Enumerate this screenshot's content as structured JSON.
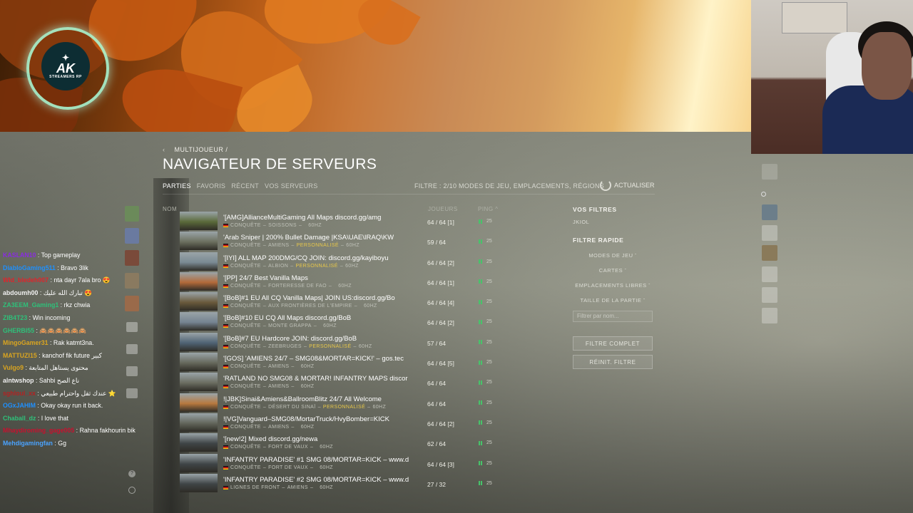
{
  "breadcrumb": {
    "back_icon": "chevron-left-icon",
    "text": "MULTIJOUEUR  /"
  },
  "page_title": "NAVIGATEUR DE SERVEURS",
  "tabs": [
    {
      "label": "PARTIES",
      "active": true
    },
    {
      "label": "FAVORIS",
      "active": false
    },
    {
      "label": "RÉCENT",
      "active": false
    },
    {
      "label": "VOS SERVEURS",
      "active": false
    }
  ],
  "filter_summary": "FILTRE : 2/10 MODES DE JEU, EMPLACEMENTS, RÉGIONS",
  "refresh_label": "ACTUALISER",
  "columns": {
    "name": "NOM",
    "players": "JOUEURS",
    "ping": "PING ^"
  },
  "servers": [
    {
      "name": "'[AMG]AllianceMultiGaming All Maps discord.gg/amg",
      "mode": "CONQUÊTE",
      "map": "SOISSONS",
      "custom": "",
      "tick": "60HZ",
      "players": "64 / 64 [1]",
      "ping": "25",
      "thumb": "#5b6a3a"
    },
    {
      "name": "'Arab Sniper | 200% Bullet Damage |KSA\\UAE\\IRAQ\\KW",
      "mode": "CONQUÊTE",
      "map": "AMIENS",
      "custom": "PERSONNALISÉ",
      "tick": "60HZ",
      "players": "59 / 64",
      "ping": "25",
      "thumb": "#6c705f"
    },
    {
      "name": "'[IYI] ALL MAP 200DMG/CQ JOIN: discord.gg/kayiboyu",
      "mode": "CONQUÊTE",
      "map": "ALBION",
      "custom": "PERSONNALISÉ",
      "tick": "60HZ",
      "players": "64 / 64 [2]",
      "ping": "25",
      "thumb": "#7a8a93"
    },
    {
      "name": "'[PP] 24/7 Best Vanilla Maps",
      "mode": "CONQUÊTE",
      "map": "FORTERESSE DE FAO",
      "custom": "",
      "tick": "60HZ",
      "players": "64 / 64 [1]",
      "ping": "25",
      "thumb": "#b36a3a"
    },
    {
      "name": "'[BoB]#1 EU All CQ Vanilla Maps| JOIN US:discord.gg/Bo",
      "mode": "CONQUÊTE",
      "map": "AUX FRONTIÈRES DE L'EMPIRE",
      "custom": "",
      "tick": "60HZ",
      "players": "64 / 64 [4]",
      "ping": "25",
      "thumb": "#6a5a3c"
    },
    {
      "name": "'[BoB]#10 EU CQ All Maps discord.gg/BoB",
      "mode": "CONQUÊTE",
      "map": "MONTE GRAPPA",
      "custom": "",
      "tick": "60HZ",
      "players": "64 / 64 [2]",
      "ping": "25",
      "thumb": "#758391"
    },
    {
      "name": "'[BoB]#7 EU Hardcore JOIN: discord.gg/BoB",
      "mode": "CONQUÊTE",
      "map": "ZEEBRUGES",
      "custom": "PERSONNALISÉ",
      "tick": "60HZ",
      "players": "57 / 64",
      "ping": "25",
      "thumb": "#4f6374"
    },
    {
      "name": "'[GOS] 'AMIENS 24/7 – SMG08&MORTAR=KICK!' – gos.tec",
      "mode": "CONQUÊTE",
      "map": "AMIENS",
      "custom": "",
      "tick": "60HZ",
      "players": "64 / 64 [5]",
      "ping": "25",
      "thumb": "#66685c"
    },
    {
      "name": "'RATLAND NO SMG08 & MORTAR! INFANTRY MAPS discor",
      "mode": "CONQUÊTE",
      "map": "AMIENS",
      "custom": "",
      "tick": "60HZ",
      "players": "64 / 64",
      "ping": "25",
      "thumb": "#6b6d61"
    },
    {
      "name": "!|JBK]Sinai&Amiens&BallroomBlitz 24/7 All Welcome",
      "mode": "CONQUÊTE",
      "map": "DÉSERT DU SINAÏ",
      "custom": "PERSONNALISÉ",
      "tick": "60HZ",
      "players": "64 / 64",
      "ping": "25",
      "thumb": "#b8793f"
    },
    {
      "name": "!|VG]Vanguard–SMG08/MortarTruck/HvyBomber=KICK",
      "mode": "CONQUÊTE",
      "map": "AMIENS",
      "custom": "",
      "tick": "60HZ",
      "players": "64 / 64 [2]",
      "ping": "25",
      "thumb": "#62655a"
    },
    {
      "name": "'[new!2] Mixed discord.gg/newa",
      "mode": "CONQUÊTE",
      "map": "FORT DE VAUX",
      "custom": "",
      "tick": "60HZ",
      "players": "62 / 64",
      "ping": "25",
      "thumb": "#3f4446"
    },
    {
      "name": "'INFANTRY PARADISE' #1 SMG 08/MORTAR=KICK – www.d",
      "mode": "CONQUÊTE",
      "map": "FORT DE VAUX",
      "custom": "",
      "tick": "60HZ",
      "players": "64 / 64 [3]",
      "ping": "25",
      "thumb": "#3f4446"
    },
    {
      "name": "'INFANTRY PARADISE' #2 SMG 08/MORTAR=KICK – www.d",
      "mode": "LIGNES DE FRONT",
      "map": "AMIENS",
      "custom": "",
      "tick": "60HZ",
      "players": "27 / 32",
      "ping": "25",
      "thumb": "#3f4446"
    }
  ],
  "filters_panel": {
    "your_filters_title": "VOS FILTRES",
    "your_filter_value": "JKIOL",
    "quick_filter_title": "FILTRE RAPIDE",
    "quick_items": [
      "MODES DE JEU",
      "CARTES",
      "EMPLACEMENTS LIBRES",
      "TAILLE DE LA PARTIE"
    ],
    "search_placeholder": "Filtrer par nom...",
    "full_filter_button": "FILTRE COMPLET",
    "reset_button": "RÉINIT. FILTRE"
  },
  "logo": {
    "text": "AK",
    "subtitle": "STREAMERS RP"
  },
  "chat": [
    {
      "user": "KASLAN10",
      "color": "#8a2be2",
      "text": "Top gameplay"
    },
    {
      "user": "DiabloGaming511",
      "color": "#1e90ff",
      "text": "Bravo 3lik"
    },
    {
      "user": "Wld_bledeh007",
      "color": "#e0242b",
      "text": "nta dayr 7ala bro 😍"
    },
    {
      "user": "abdoumh00",
      "color": "#f0f0f0",
      "text": "تبارك الله عليك 😍"
    },
    {
      "user": "ZA3EEM_Gaming1",
      "color": "#2fc07a",
      "text": "rkz chwia"
    },
    {
      "user": "ZIB4T23",
      "color": "#2fc07a",
      "text": "Win incoming"
    },
    {
      "user": "GHERBI55",
      "color": "#2fc07a",
      "text": "🙈🙈🙈🙈🙈🙈"
    },
    {
      "user": "MingoGamer31",
      "color": "#daa520",
      "text": "Rak katmt3na."
    },
    {
      "user": "MATTUZI15",
      "color": "#daa520",
      "text": "kanchof fik future كبير"
    },
    {
      "user": "Vulgo9",
      "color": "#daa520",
      "text": "محتوى يستاهل المتابعة"
    },
    {
      "user": "alntwshop",
      "color": "#f0f0f0",
      "text": "Sahbi ناع الصح"
    },
    {
      "user": "sghloul_xx",
      "color": "#b22222",
      "text": "عندك ثقل واحترام طبيعي ⭐"
    },
    {
      "user": "OGxJAHIM",
      "color": "#1e90ff",
      "text": "Okay okay run it back."
    },
    {
      "user": "Chaball_dz",
      "color": "#2fc07a",
      "text": "I love that"
    },
    {
      "user": "Mhaydiroming_gage005",
      "color": "#c8102e",
      "text": "Rahna fakhourin bik"
    },
    {
      "user": "Mehdigamingfan",
      "color": "#4aa3ff",
      "text": "Gg"
    }
  ]
}
